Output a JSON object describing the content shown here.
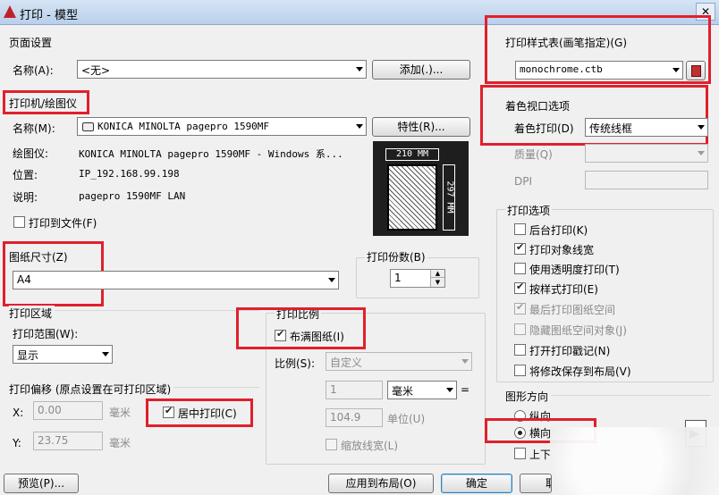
{
  "window": {
    "title": "打印 - 模型",
    "close": "✕"
  },
  "page_setup": {
    "section": "页面设置",
    "name_label": "名称(A):",
    "name_value": "<无>",
    "add_button": "添加(.)..."
  },
  "printer": {
    "section": "打印机/绘图仪",
    "name_label": "名称(M):",
    "name_value": "KONICA MINOLTA pagepro 1590MF",
    "props_button": "特性(R)...",
    "plotter_label": "绘图仪:",
    "plotter_value": "KONICA MINOLTA pagepro 1590MF - Windows 系...",
    "location_label": "位置:",
    "location_value": "IP_192.168.99.198",
    "desc_label": "说明:",
    "desc_value": "pagepro 1590MF LAN",
    "print_to_file": "打印到文件(F)",
    "paper_w": "210 MM",
    "paper_h": "297 MM"
  },
  "paper_size": {
    "section": "图纸尺寸(Z)",
    "value": "A4"
  },
  "copies": {
    "section": "打印份数(B)",
    "value": "1"
  },
  "area": {
    "section": "打印区域",
    "range_label": "打印范围(W):",
    "range_value": "显示"
  },
  "offset": {
    "section": "打印偏移 (原点设置在可打印区域)",
    "x_label": "X:",
    "x_value": "0.00",
    "x_unit": "毫米",
    "y_label": "Y:",
    "y_value": "23.75",
    "y_unit": "毫米",
    "center": "居中打印(C)"
  },
  "scale": {
    "section": "打印比例",
    "fit": "布满图纸(I)",
    "ratio_label": "比例(S):",
    "ratio_value": "自定义",
    "val1": "1",
    "unit1": "毫米",
    "eq": "=",
    "val2": "104.9",
    "unit2": "单位(U)",
    "lineweights": "缩放线宽(L)"
  },
  "style_table": {
    "section": "打印样式表(画笔指定)(G)",
    "value": "monochrome.ctb"
  },
  "shaded": {
    "section": "着色视口选项",
    "shade_label": "着色打印(D)",
    "shade_value": "传统线框",
    "quality_label": "质量(Q)",
    "dpi_label": "DPI"
  },
  "options": {
    "section": "打印选项",
    "items": [
      "后台打印(K)",
      "打印对象线宽",
      "使用透明度打印(T)",
      "按样式打印(E)",
      "最后打印图纸空间",
      "隐藏图纸空间对象(J)",
      "打开打印戳记(N)",
      "将修改保存到布局(V)"
    ]
  },
  "orientation": {
    "section": "图形方向",
    "portrait": "纵向",
    "landscape": "横向",
    "upside": "上下"
  },
  "buttons": {
    "preview": "预览(P)...",
    "apply": "应用到布局(O)",
    "ok": "确定",
    "cancel": "取"
  }
}
